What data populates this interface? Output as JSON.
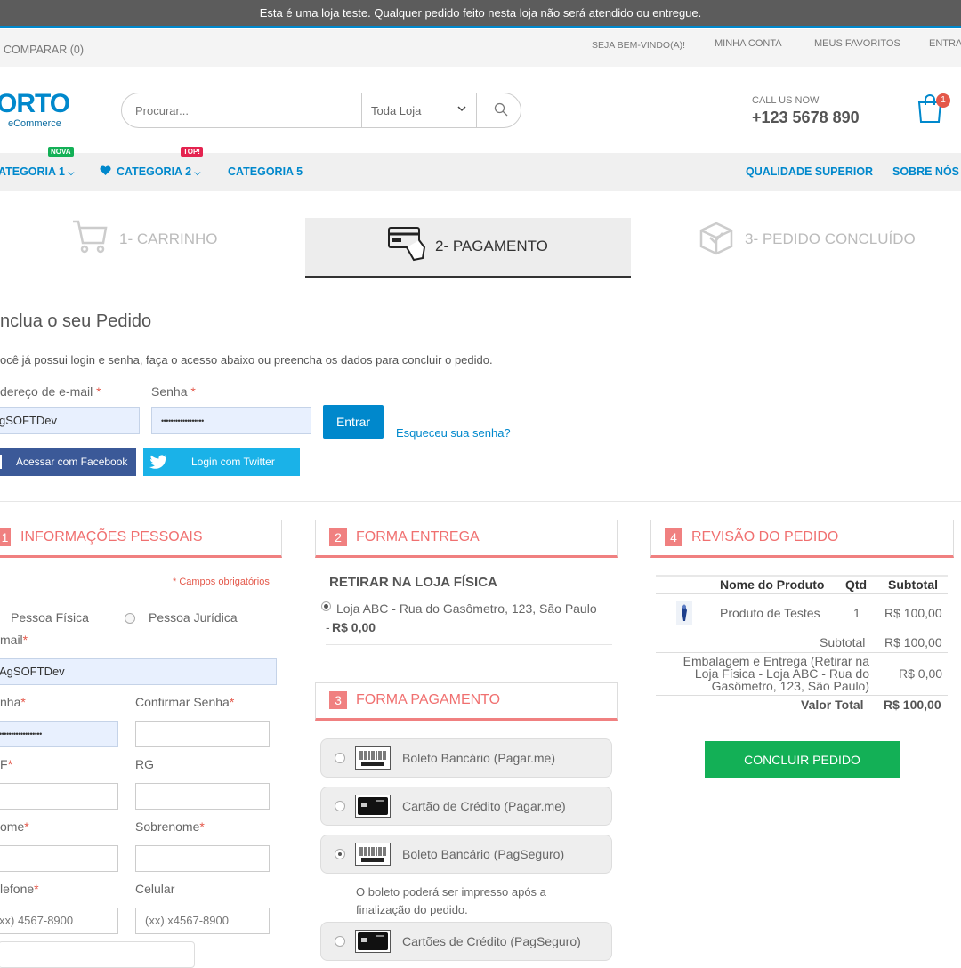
{
  "notice": "Esta é uma loja teste. Qualquer pedido feito nesta loja não será atendido ou entregue.",
  "topbar": {
    "compare": "COMPARAR (0)",
    "welcome": "SEJA BEM-VINDO(A)!",
    "account": "MINHA CONTA",
    "favorites": "MEUS FAVORITOS",
    "enter": "ENTRA"
  },
  "header": {
    "logo": "ORTO",
    "logo_sub": "eCommerce",
    "search_placeholder": "Procurar...",
    "scope": "Toda Loja",
    "call_label": "CALL US NOW",
    "phone": "+123 5678 890",
    "cart_count": "1"
  },
  "nav": {
    "cat1": "ATEGORIA 1",
    "cat1_tip": "NOVA",
    "cat2": "CATEGORIA 2",
    "cat2_tip": "TOP!",
    "cat5": "CATEGORIA 5",
    "quality": "QUALIDADE SUPERIOR",
    "about": "SOBRE NÓS"
  },
  "steps": {
    "s1": "1- CARRINHO",
    "s2": "2- PAGAMENTO",
    "s3": "3- PEDIDO CONCLUÍDO"
  },
  "login": {
    "title": "nclua o seu Pedido",
    "subtitle": "ocê já possui login e senha, faça o acesso abaixo ou preencha os dados para concluir o pedido.",
    "email_label": "dereço de e-mail",
    "password_label": "Senha",
    "email_value": "gSOFTDev",
    "password_value": "••••••••••••••••••",
    "enter_button": "Entrar",
    "forgot": "Esqueceu sua senha?",
    "facebook": "Acessar com Facebook",
    "twitter": "Login com Twitter",
    "asterisk": "*"
  },
  "personal": {
    "num": "1",
    "title": "INFORMAÇÕES PESSOAIS",
    "required_note": "* Campos obrigatórios",
    "pf": "Pessoa Física",
    "pj": "Pessoa Jurídica",
    "email_label": "mail",
    "email_value": "AgSOFTDev",
    "pass_label": "nha",
    "pass_value": "••••••••••••••••••",
    "confirm_label": "Confirmar Senha",
    "cpf_label": "F",
    "rg_label": "RG",
    "name_label": "ome",
    "surname_label": "Sobrenome",
    "phone_label": "lefone",
    "phone_placeholder": "xx) 4567-8900",
    "mobile_label": "Celular",
    "mobile_placeholder": "(xx) x4567-8900",
    "asterisk": "*"
  },
  "delivery": {
    "num": "2",
    "title": "FORMA ENTREGA",
    "method": "RETIRAR NA LOJA FÍSICA",
    "option": "Loja ABC - Rua do Gasômetro, 123, São Paulo",
    "price_prefix": "- ",
    "price": "R$ 0,00"
  },
  "payment": {
    "num": "3",
    "title": "FORMA PAGAMENTO",
    "opt1": "Boleto Bancário (Pagar.me)",
    "opt2": "Cartão de Crédito (Pagar.me)",
    "opt3": "Boleto Bancário (PagSeguro)",
    "note": "O boleto poderá ser impresso após a finalização do pedido.",
    "opt4": "Cartões de Crédito (PagSeguro)"
  },
  "review": {
    "num": "4",
    "title": "REVISÃO DO PEDIDO",
    "col_name": "Nome do Produto",
    "col_qty": "Qtd",
    "col_sub": "Subtotal",
    "product": "Produto de Testes",
    "qty": "1",
    "price": "R$ 100,00",
    "subtotal_label": "Subtotal",
    "subtotal": "R$ 100,00",
    "shipping_label": "Embalagem e Entrega (Retirar na Loja Física - Loja ABC - Rua do Gasômetro, 123, São Paulo)",
    "shipping": "R$ 0,00",
    "total_label": "Valor Total",
    "total": "R$ 100,00",
    "button": "CONCLUIR PEDIDO"
  },
  "colors": {
    "accent": "#0088cc",
    "section": "#f08080",
    "success": "#13b056",
    "facebook": "#3b5998",
    "twitter": "#1ab2e8"
  }
}
